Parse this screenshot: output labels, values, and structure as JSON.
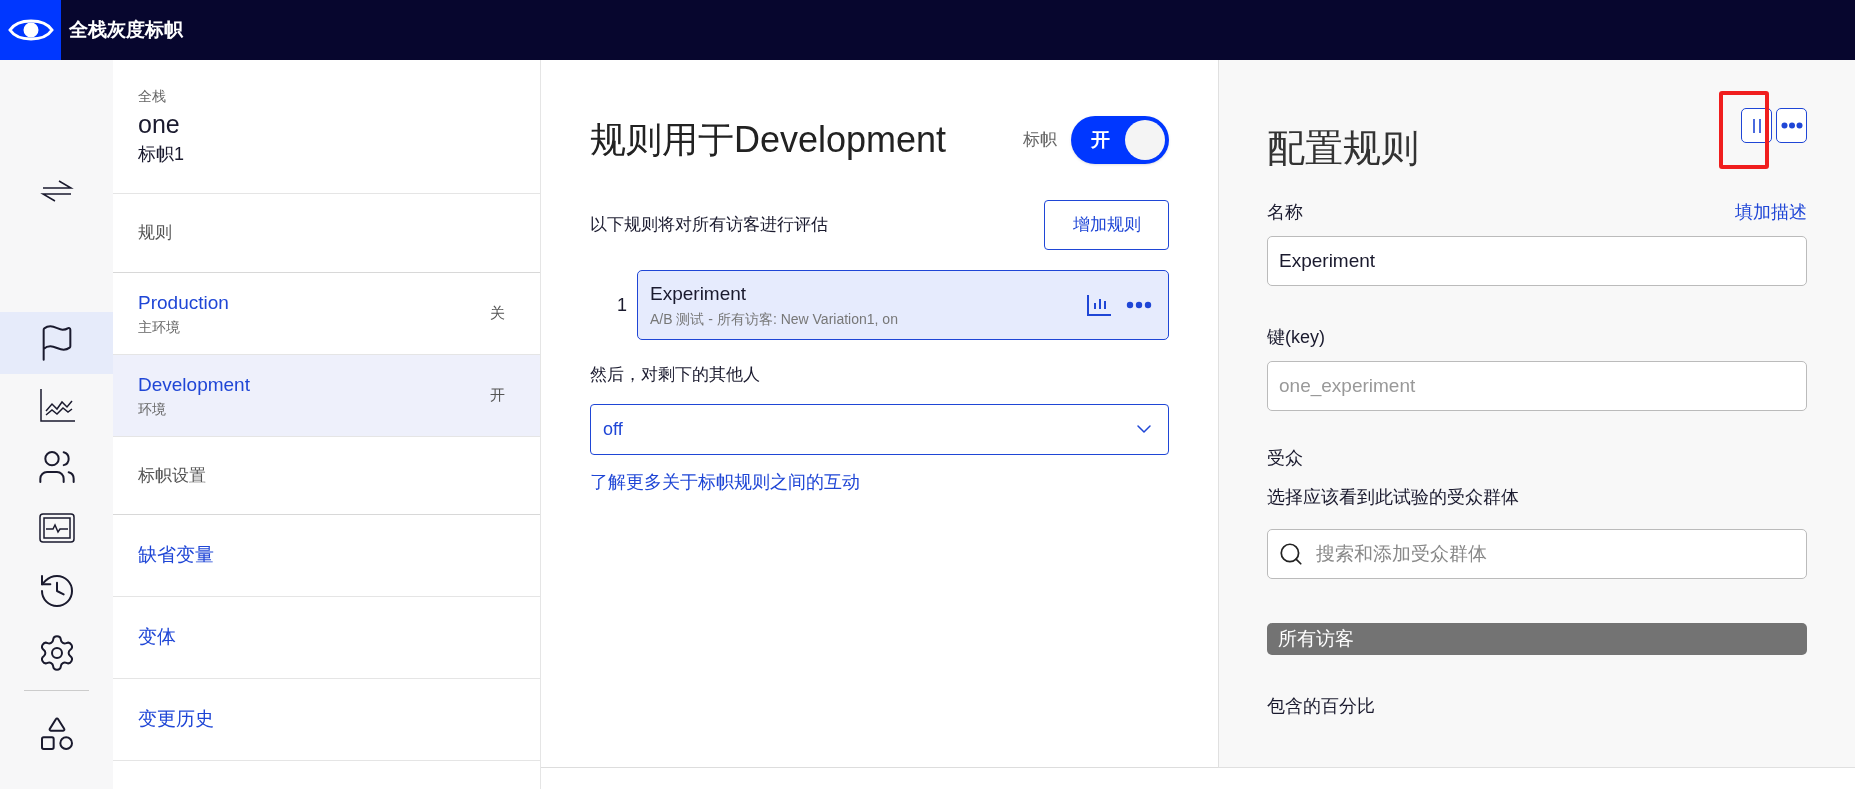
{
  "header": {
    "title": "全栈灰度标帜"
  },
  "rail_items": [
    {
      "kind": "swap",
      "selected": false
    },
    {
      "kind": "flag",
      "selected": true
    },
    {
      "kind": "chart",
      "selected": false
    },
    {
      "kind": "users",
      "selected": false
    },
    {
      "kind": "monitor",
      "selected": false
    },
    {
      "kind": "history",
      "selected": false
    },
    {
      "kind": "settings",
      "selected": false
    },
    {
      "kind": "shapes",
      "selected": false
    }
  ],
  "flag": {
    "project": "全栈",
    "name": "one",
    "key": "标帜1"
  },
  "rules_section": {
    "heading": "规则",
    "environments": [
      {
        "name": "Production",
        "description": "主环境",
        "status": "关",
        "selected": false
      },
      {
        "name": "Development",
        "description": "环境",
        "status": "开",
        "selected": true
      }
    ]
  },
  "settings_section": {
    "heading": "标帜设置",
    "items": [
      "缺省变量",
      "变体",
      "变更历史"
    ]
  },
  "main": {
    "title": "规则用于Development",
    "toggle": {
      "label": "标帜",
      "text": "开",
      "on": true
    },
    "intro": "以下规则将对所有访客进行评估",
    "add_button": "增加规则",
    "rules": [
      {
        "index": "1",
        "name": "Experiment",
        "summary": "A/B 测试 - 所有访客: New Variation1, on",
        "selected": true
      }
    ],
    "fallback_label": "然后，对剩下的其他人",
    "fallback_value": "off",
    "learn_more": "了解更多关于标帜规则之间的互动"
  },
  "config": {
    "title": "配置规则",
    "name_label": "名称",
    "add_description": "填加描述",
    "name_value": "Experiment",
    "key_label": "键(key)",
    "key_placeholder": "one_experiment",
    "audience_label": "受众",
    "audience_hint": "选择应该看到此试验的受众群体",
    "audience_placeholder": "搜索和添加受众群体",
    "audience_tag": "所有访客",
    "percentage_label": "包含的百分比"
  }
}
